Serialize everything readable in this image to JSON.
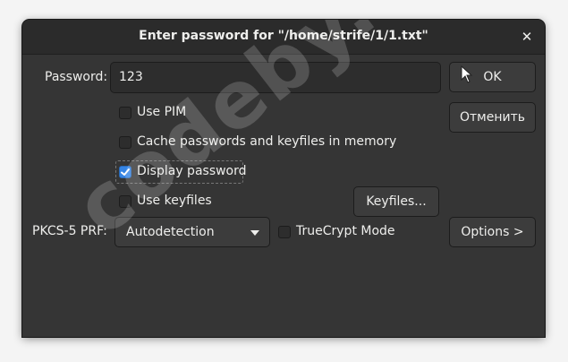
{
  "dialog": {
    "title": "Enter password for \"/home/strife/1/1.txt\"",
    "close_icon": "close-icon"
  },
  "password": {
    "label": "Password:",
    "value": "123"
  },
  "buttons": {
    "ok": "OK",
    "cancel": "Отменить",
    "keyfiles": "Keyfiles...",
    "options": "Options >"
  },
  "checkboxes": {
    "use_pim": {
      "label": "Use PIM",
      "checked": false
    },
    "cache": {
      "label": "Cache passwords and keyfiles in memory",
      "checked": false
    },
    "display_password": {
      "label": "Display password",
      "checked": true
    },
    "use_keyfiles": {
      "label": "Use keyfiles",
      "checked": false
    },
    "truecrypt": {
      "label": "TrueCrypt Mode",
      "checked": false
    }
  },
  "prf": {
    "label": "PKCS-5 PRF:",
    "selected": "Autodetection"
  },
  "watermark": "codeby.net",
  "colors": {
    "accent": "#3584e4",
    "window_bg": "#353535"
  }
}
